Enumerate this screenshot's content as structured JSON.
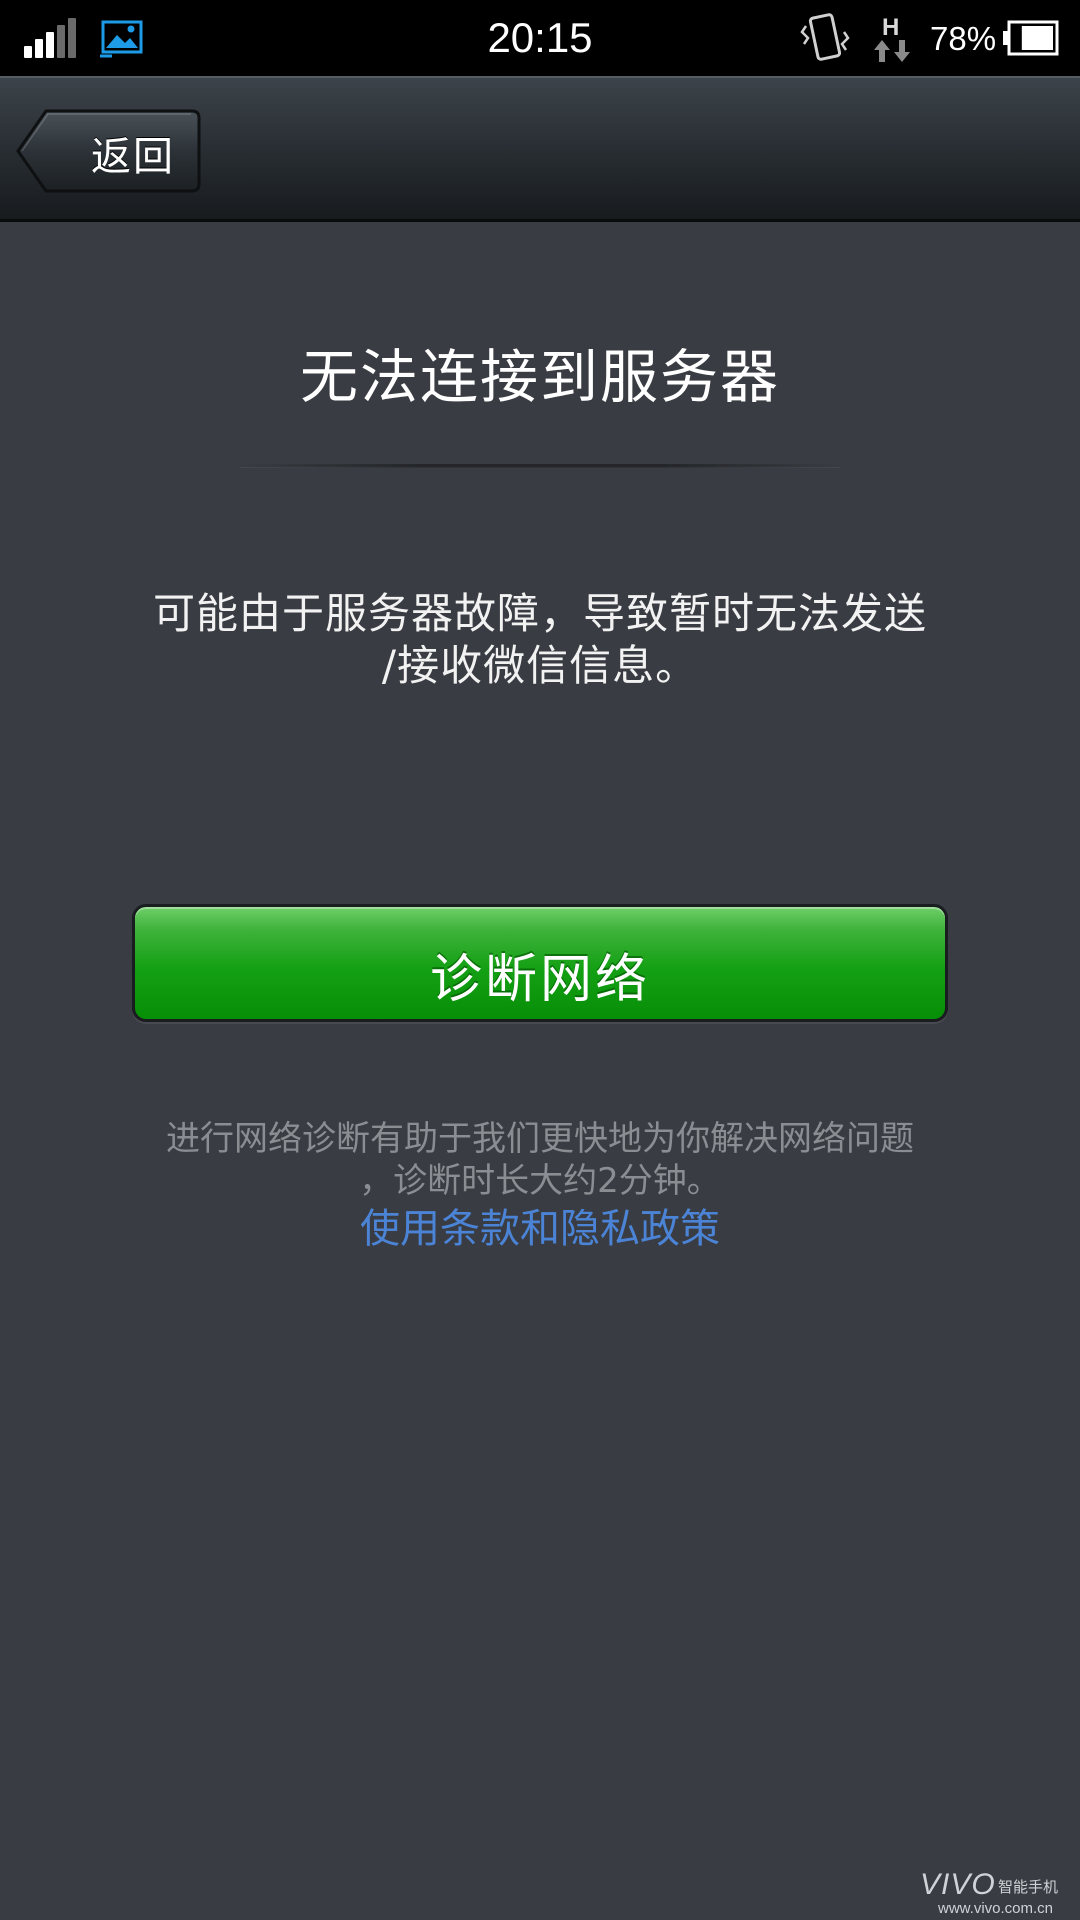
{
  "status_bar": {
    "time": "20:15",
    "battery_percent": "78%",
    "network_type": "H",
    "signal_bars_active": 3,
    "signal_bars_total": 5,
    "battery_level": 0.78,
    "icons": [
      "signal-icon",
      "gallery-notification-icon",
      "vibrate-icon",
      "hspa-data-icon",
      "battery-icon"
    ]
  },
  "header": {
    "back_label": "返回"
  },
  "main": {
    "title": "无法连接到服务器",
    "message": "可能由于服务器故障，导致暂时无法发送\n/接收微信信息。",
    "diagnose_button_label": "诊断网络",
    "diagnose_hint": "进行网络诊断有助于我们更快地为你解决网络问题\n，诊断时长大约2分钟。",
    "terms_link": "使用条款和隐私政策"
  },
  "watermark": {
    "brand": "VIVO",
    "tagline": "智能手机",
    "url": "www.vivo.com.cn"
  },
  "colors": {
    "background": "#393c42",
    "status_bar": "#000000",
    "primary_button": "#14a014",
    "link": "#4b84d6",
    "hint_text": "#8a8d92",
    "accent_icon": "#1e9be6"
  }
}
